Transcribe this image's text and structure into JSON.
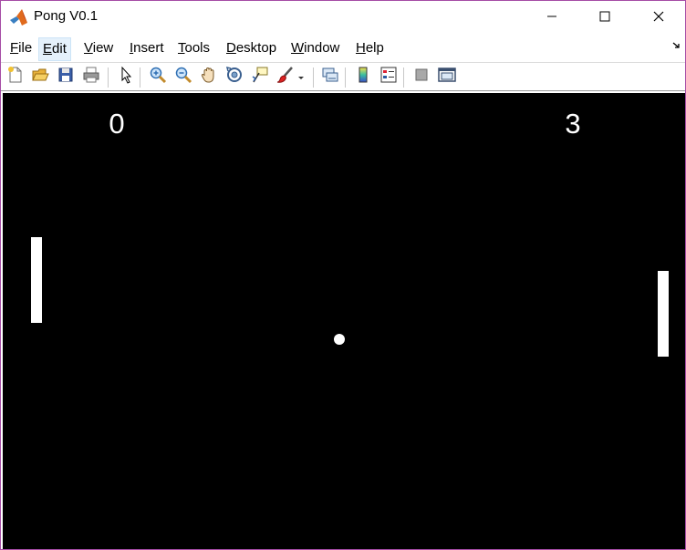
{
  "window": {
    "title": "Pong V0.1",
    "border_color": "#a64ca6"
  },
  "title_bar": {
    "app_icon": "matlab-icon",
    "controls": [
      {
        "name": "minimize",
        "icon": "minimize-icon"
      },
      {
        "name": "maximize",
        "icon": "maximize-icon"
      },
      {
        "name": "close",
        "icon": "close-icon"
      }
    ]
  },
  "menu": {
    "items": [
      {
        "label": "File",
        "mnemonic": "F",
        "rest": "ile"
      },
      {
        "label": "Edit",
        "mnemonic": "E",
        "rest": "dit",
        "active": true
      },
      {
        "label": "View",
        "mnemonic": "V",
        "rest": "iew"
      },
      {
        "label": "Insert",
        "mnemonic": "I",
        "rest": "nsert"
      },
      {
        "label": "Tools",
        "mnemonic": "T",
        "rest": "ools"
      },
      {
        "label": "Desktop",
        "mnemonic": "D",
        "rest": "esktop"
      },
      {
        "label": "Window",
        "mnemonic": "W",
        "rest": "indow"
      },
      {
        "label": "Help",
        "mnemonic": "H",
        "rest": "elp"
      }
    ],
    "dock_icon": "dock-arrow-icon"
  },
  "toolbar": {
    "buttons": [
      "new-figure-icon",
      "open-file-icon",
      "save-icon",
      "print-icon",
      "select-pointer-icon",
      "zoom-in-icon",
      "zoom-out-icon",
      "pan-hand-icon",
      "rotate-3d-icon",
      "data-cursor-icon",
      "brush-icon",
      "brush-dropdown-icon",
      "link-plot-icon",
      "insert-colorbar-icon",
      "insert-legend-icon",
      "hide-plot-tools-icon",
      "show-plot-tools-icon"
    ]
  },
  "game": {
    "background": "#000000",
    "foreground": "#ffffff",
    "score_left": "0",
    "score_right": "3"
  }
}
